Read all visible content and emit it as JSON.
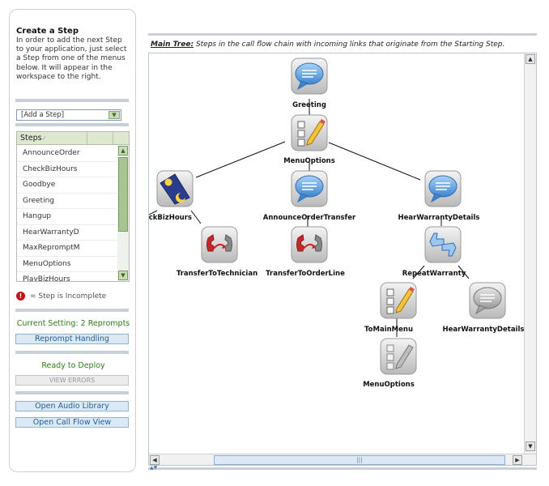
{
  "sidebar": {
    "title": "Create a Step",
    "instructions": "In order to add the next Step to your application, just select a Step from one of the menus below. It will appear in the workspace to the right.",
    "add_step_select": "[Add a Step]",
    "steps_header": "Steps",
    "steps": [
      "AnnounceOrder",
      "CheckBizHours",
      "Goodbye",
      "Greeting",
      "Hangup",
      "HearWarrantyD",
      "MaxRepromptM",
      "MenuOptions",
      "PlayBizHours"
    ],
    "incomplete_icon": "!",
    "incomplete_legend": "= Step is Incomplete",
    "current_setting": "Current Setting: 2 Reprompts",
    "reprompt_button": "Reprompt Handling",
    "deploy_status": "Ready to Deploy",
    "view_errors_button": "VIEW ERRORS",
    "open_audio_button": "Open Audio Library",
    "open_callflow_button": "Open Call Flow View"
  },
  "main": {
    "caption_label": "Main Tree:",
    "caption_text": "Steps in the call flow chain with incoming links that originate from the Starting Step.",
    "nodes": [
      {
        "id": "greeting",
        "label": "Greeting",
        "icon": "speech-bubble-icon"
      },
      {
        "id": "menuoptions",
        "label": "MenuOptions",
        "icon": "menu-pencil-icon"
      },
      {
        "id": "checkbizhours",
        "label": "eckBizHours",
        "icon": "day-night-icon"
      },
      {
        "id": "announceordertransfer",
        "label": "AnnounceOrderTransfer",
        "icon": "speech-bubble-icon"
      },
      {
        "id": "hearwarrantydetails",
        "label": "HearWarrantyDetails",
        "icon": "speech-bubble-icon"
      },
      {
        "id": "transfertotechnician",
        "label": "TransferToTechnician",
        "icon": "phone-transfer-icon"
      },
      {
        "id": "transfertoorderline",
        "label": "TransferToOrderLine",
        "icon": "phone-transfer-icon"
      },
      {
        "id": "repeatwarranty",
        "label": "RepeatWarranty",
        "icon": "thumbs-up-down-icon"
      },
      {
        "id": "tomainmenu",
        "label": "ToMainMenu",
        "icon": "menu-pencil-icon"
      },
      {
        "id": "hearwarrantydetails2",
        "label": "HearWarrantyDetails",
        "icon": "speech-bubble-grey-icon"
      },
      {
        "id": "menuoptions2",
        "label": "MenuOptions",
        "icon": "menu-pencil-grey-icon"
      }
    ]
  },
  "colors": {
    "accent_green": "#2e7d1b",
    "button_blue": "#1f5f99",
    "error_red": "#c0141b",
    "bubble_blue": "#5a9ad8"
  }
}
